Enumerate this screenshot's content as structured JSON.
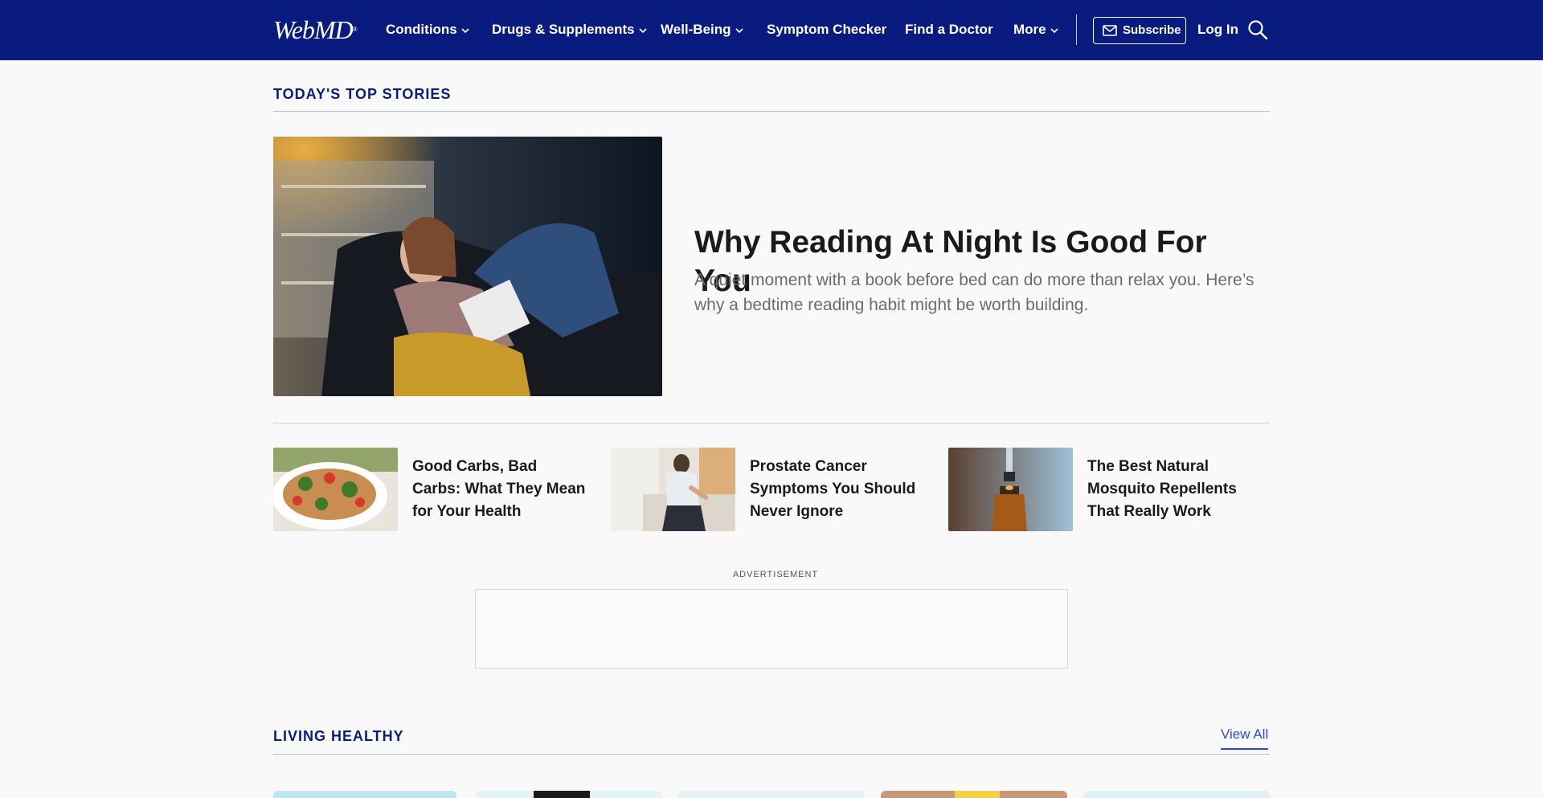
{
  "header": {
    "logo_text": "WebMD",
    "nav": [
      {
        "label": "Conditions",
        "has_dropdown": true
      },
      {
        "label": "Drugs & Supplements",
        "has_dropdown": true
      },
      {
        "label": "Well-Being",
        "has_dropdown": true
      },
      {
        "label": "Symptom Checker",
        "has_dropdown": false
      },
      {
        "label": "Find a Doctor",
        "has_dropdown": false
      },
      {
        "label": "More",
        "has_dropdown": true
      }
    ],
    "subscribe_label": "Subscribe",
    "login_label": "Log In",
    "icons": {
      "search": "search-icon",
      "mail": "mail-icon",
      "dropdown": "chevron-down-icon"
    }
  },
  "top_stories": {
    "heading": "TODAY'S TOP STORIES",
    "hero": {
      "title": "Why Reading At Night Is Good For You",
      "description": "A quiet moment with a book before bed can do more than relax you. Here’s why a bedtime reading habit might be worth building."
    },
    "stories": [
      {
        "title": "Good Carbs, Bad Carbs: What They Mean for Your Health"
      },
      {
        "title": "Prostate Cancer Symptoms You Should Never Ignore"
      },
      {
        "title": "The Best Natural Mosquito Repellents That Really Work"
      }
    ]
  },
  "ad": {
    "label": "ADVERTISEMENT"
  },
  "living_healthy": {
    "heading": "LIVING HEALTHY",
    "view_all_label": "View All"
  },
  "colors": {
    "header_bg": "#0a1b80",
    "section_heading": "#0a1b80",
    "link": "#2f4bd1",
    "page_bg": "#f9f9f9"
  }
}
